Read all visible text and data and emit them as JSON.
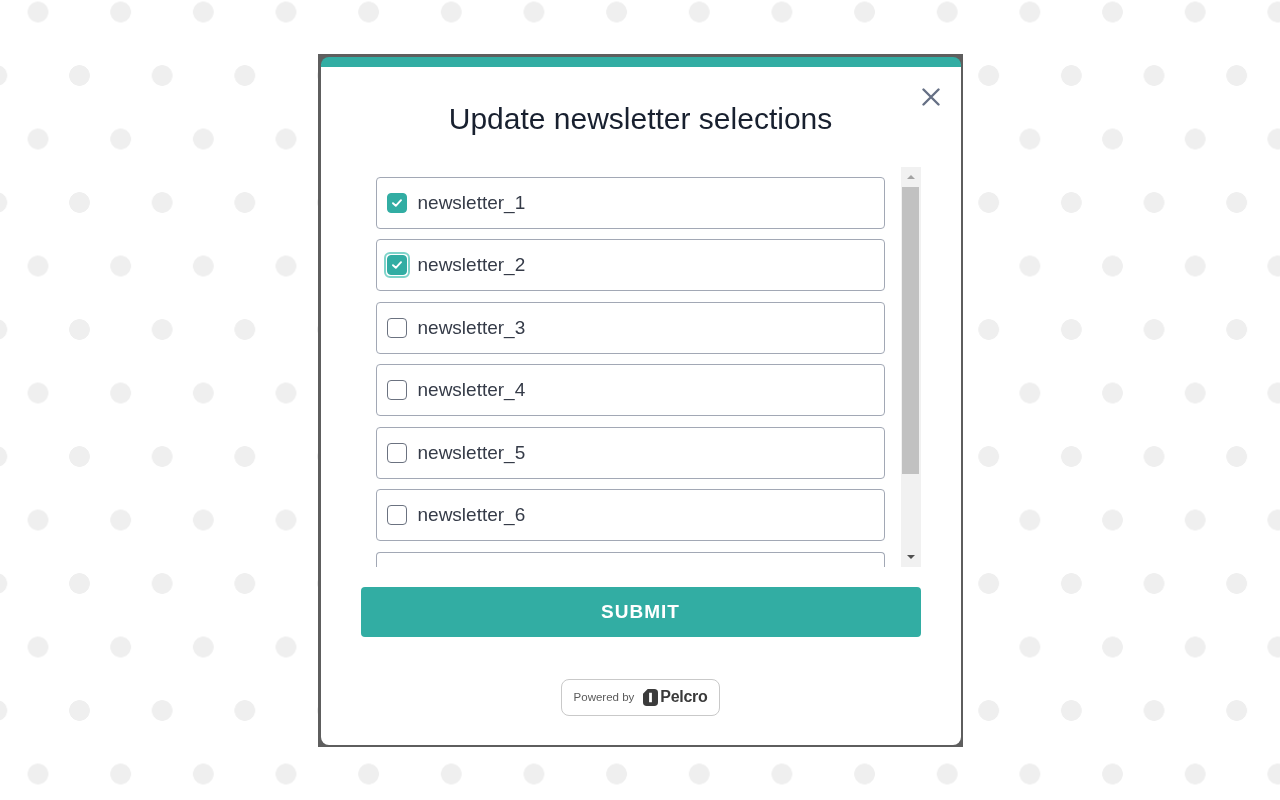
{
  "dialog": {
    "title": "Update newsletter selections",
    "newsletters": [
      {
        "label": "newsletter_1",
        "checked": true,
        "focused": false
      },
      {
        "label": "newsletter_2",
        "checked": true,
        "focused": true
      },
      {
        "label": "newsletter_3",
        "checked": false,
        "focused": false
      },
      {
        "label": "newsletter_4",
        "checked": false,
        "focused": false
      },
      {
        "label": "newsletter_5",
        "checked": false,
        "focused": false
      },
      {
        "label": "newsletter_6",
        "checked": false,
        "focused": false
      }
    ],
    "more_below": true,
    "submit_button": "SUBMIT",
    "footer": {
      "powered_by": "Powered by",
      "brand": "Pelcro"
    }
  }
}
